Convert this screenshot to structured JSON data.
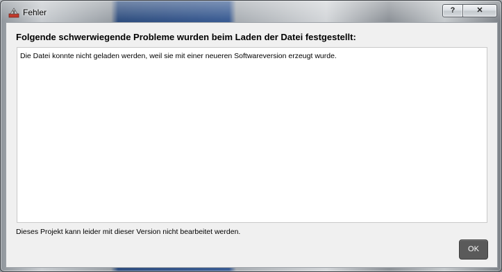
{
  "window": {
    "title": "Fehler",
    "app_icon": "app-logo-icon",
    "help_button_label": "?",
    "close_button_label": "✕"
  },
  "dialog": {
    "heading": "Folgende schwerwiegende Probleme wurden beim Laden der Datei festgestellt:",
    "details_text": "Die Datei konnte nicht geladen werden, weil sie mit einer neueren Softwareversion erzeugt wurde.",
    "footer_text": "Dieses Projekt kann leider mit dieser Version nicht bearbeitet werden.",
    "ok_label": "OK"
  },
  "colors": {
    "client_background": "#f0f0f0",
    "ok_button_background": "#5a5a5a",
    "ok_button_text": "#ffffff"
  }
}
